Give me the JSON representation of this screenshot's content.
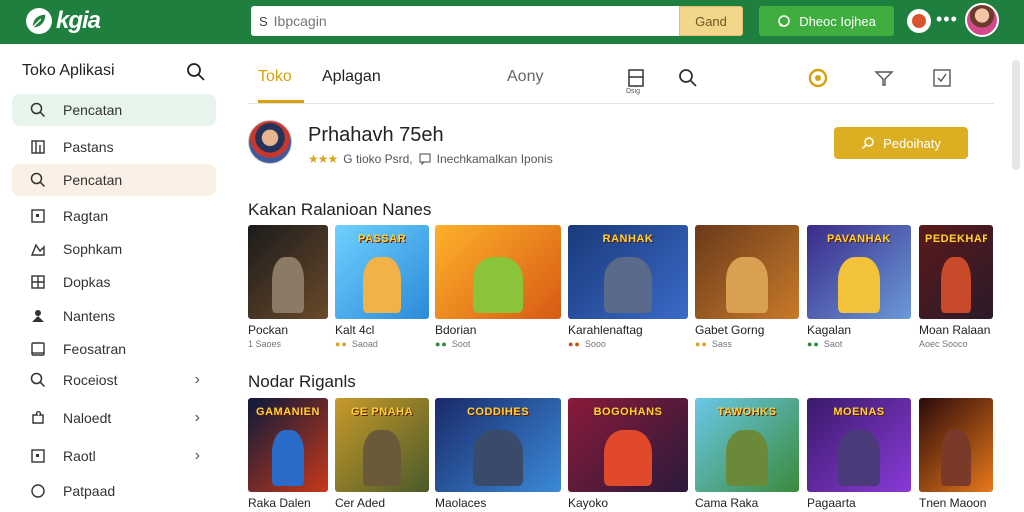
{
  "header": {
    "logo_text": "kgia",
    "search_placeholder": "Ibpcagin",
    "search_prefix": "S",
    "search_button": "Gand",
    "green_button": "Dheoc Iojhea",
    "more": "•••"
  },
  "sidebar": {
    "title": "Toko Aplikasi",
    "items": [
      {
        "label": "Pencatan",
        "icon": "search-icon"
      },
      {
        "label": "Pastans",
        "icon": "book-icon"
      },
      {
        "label": "Pencatan",
        "icon": "search-icon"
      },
      {
        "label": "Ragtan",
        "icon": "square-icon"
      },
      {
        "label": "Sophkam",
        "icon": "gallery-icon"
      },
      {
        "label": "Dopkas",
        "icon": "grid-icon"
      },
      {
        "label": "Nantens",
        "icon": "person-icon"
      },
      {
        "label": "Feosatran",
        "icon": "window-icon"
      },
      {
        "label": "Roceiost",
        "icon": "search-icon",
        "chevron": "›"
      },
      {
        "label": "Naloedt",
        "icon": "puzzle-icon",
        "chevron": "›"
      },
      {
        "label": "Raotl",
        "icon": "square-icon",
        "chevron": "›"
      },
      {
        "label": "Patpaad",
        "icon": "circle-icon"
      }
    ]
  },
  "tabs": {
    "items": [
      "Toko",
      "Aplagan",
      "Aony"
    ],
    "icon_caption": "Dsig"
  },
  "profile": {
    "name": "Prhahavh 75eh",
    "rating_stars": "★★★",
    "rating_text": "G tioko Psrd,",
    "meta_text": "Inechkamalkan Iponis",
    "follow_button": "Pedoihaty"
  },
  "sections": [
    {
      "title": "Kakan Ralanioan Nanes",
      "cards": [
        {
          "name": "Pockan",
          "meta": "1 Saoes",
          "dots": "",
          "banner": "",
          "bg": [
            "#1b1b1b",
            "#6a4a2a"
          ],
          "hero": "#8a7a66"
        },
        {
          "name": "Kalt 4cl",
          "meta": "Saoad",
          "dots": "●● ",
          "banner": "PASSAR",
          "bg": [
            "#6fd0ff",
            "#2a8ad8"
          ],
          "hero": "#f2b24a"
        },
        {
          "name": "Bdorian",
          "meta": "Soot",
          "dots": "●● ",
          "banner": "",
          "bg": [
            "#ffb12a",
            "#d65a14"
          ],
          "hero": "#8bc43a"
        },
        {
          "name": "Karahlenaftag",
          "meta": "Sooo",
          "dots": "●● ",
          "banner": "RANHAK",
          "bg": [
            "#1a3a7a",
            "#3a6ac8"
          ],
          "hero": "#5a6a8a"
        },
        {
          "name": "Gabet Gorng",
          "meta": "Sass",
          "dots": "●● ",
          "banner": "",
          "bg": [
            "#6a3a1a",
            "#c87a2a"
          ],
          "hero": "#d8a050"
        },
        {
          "name": "Kagalan",
          "meta": "Saot",
          "dots": "●● ",
          "banner": "PAVANHAK",
          "bg": [
            "#3a2a8a",
            "#6a9ad8"
          ],
          "hero": "#f2c23a"
        },
        {
          "name": "Moan Ralaan",
          "meta": "Aoec Sooco",
          "dots": "",
          "banner": "PEDEKHAR",
          "bg": [
            "#5a1a1a",
            "#2a1a2a"
          ],
          "hero": "#c84a2a"
        }
      ]
    },
    {
      "title": "Nodar Riganls",
      "cards": [
        {
          "name": "Raka Dalen",
          "meta": "",
          "dots": "",
          "banner": "GAMANIEN",
          "bg": [
            "#0a1a3a",
            "#c8381a"
          ],
          "hero": "#2a6ac8"
        },
        {
          "name": "Cer Aded",
          "meta": "",
          "dots": "",
          "banner": "GE PNAHA",
          "bg": [
            "#c89a2a",
            "#4a5a2a"
          ],
          "hero": "#6a5a3a"
        },
        {
          "name": "Maolaces",
          "meta": "",
          "dots": "",
          "banner": "CODDIHES",
          "bg": [
            "#1a2a6a",
            "#3a8ad8"
          ],
          "hero": "#3a4a6a"
        },
        {
          "name": "Kayoko",
          "meta": "",
          "dots": "",
          "banner": "BOGOHANS",
          "bg": [
            "#8a1a3a",
            "#2a1a3a"
          ],
          "hero": "#e04a2a"
        },
        {
          "name": "Cama Raka",
          "meta": "",
          "dots": "",
          "banner": "TAWOHKS",
          "bg": [
            "#6ac8e8",
            "#3a8a3a"
          ],
          "hero": "#6a8a3a"
        },
        {
          "name": "Pagaarta",
          "meta": "",
          "dots": "",
          "banner": "MOENAS",
          "bg": [
            "#3a1a6a",
            "#8a3ad8"
          ],
          "hero": "#4a3a7a"
        },
        {
          "name": "Tnen Maoon",
          "meta": "",
          "dots": "",
          "banner": "",
          "bg": [
            "#2a0a0a",
            "#e8781a"
          ],
          "hero": "#7a3a2a"
        }
      ]
    }
  ],
  "colors": {
    "brand_green": "#1e7f3e",
    "accent_gold": "#d4a10f",
    "button_green": "#3fae3f"
  }
}
